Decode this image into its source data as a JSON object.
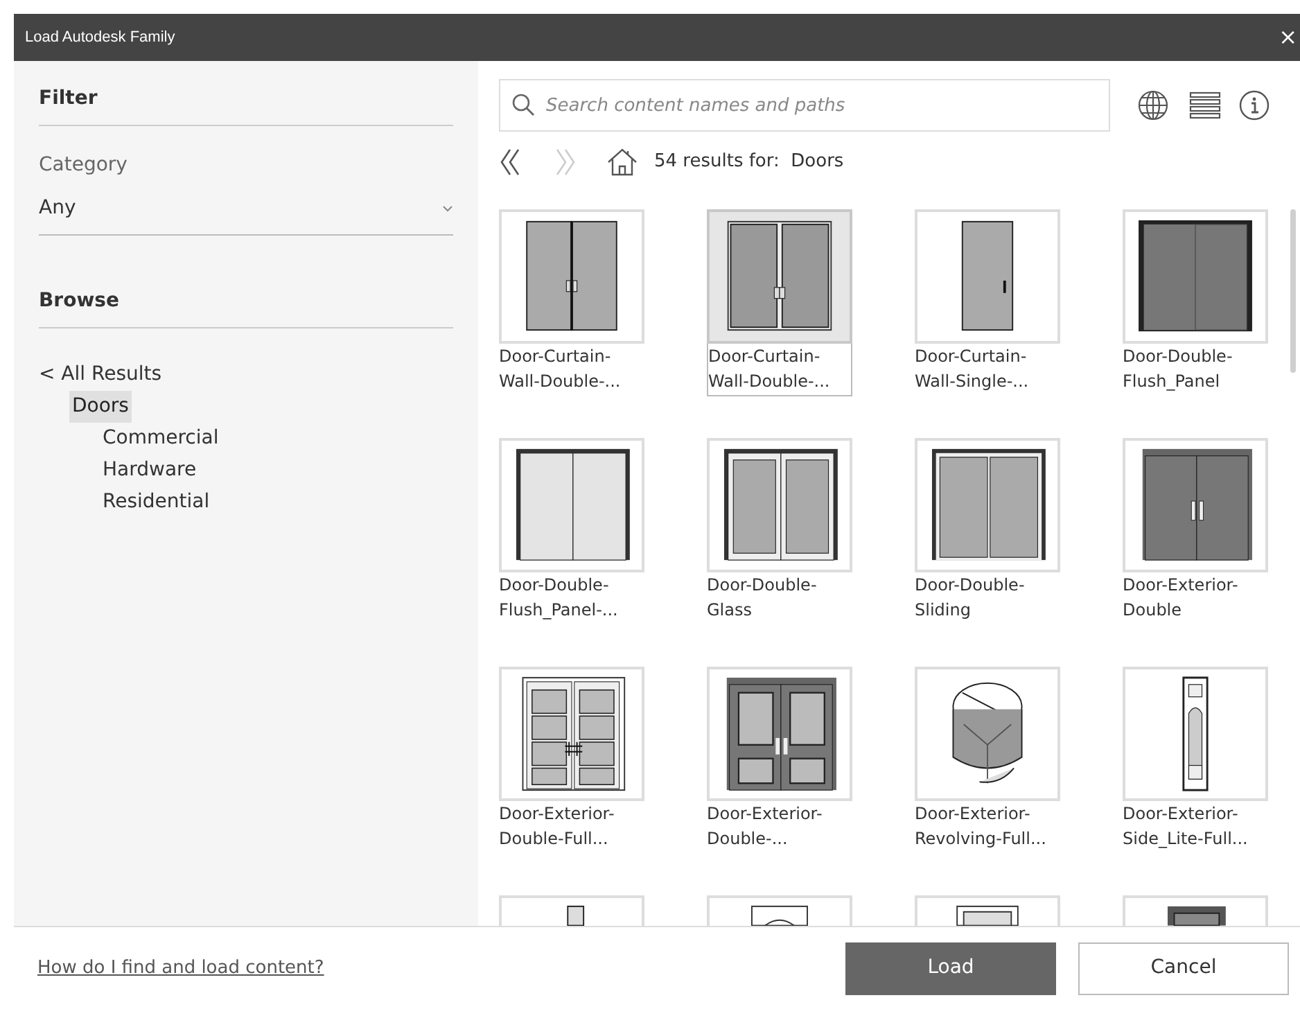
{
  "window": {
    "title": "Load Autodesk Family",
    "close": "×"
  },
  "filter": {
    "heading": "Filter",
    "category_label": "Category",
    "category_value": "Any"
  },
  "browse": {
    "heading": "Browse",
    "back_link": "< All Results",
    "tree": [
      {
        "label": "Doors",
        "selected": true,
        "children": [
          {
            "label": "Commercial",
            "selected": false
          },
          {
            "label": "Hardware",
            "selected": false
          },
          {
            "label": "Residential",
            "selected": false
          }
        ]
      }
    ]
  },
  "search": {
    "placeholder": "Search content names and paths"
  },
  "nav": {
    "back_disabled": false,
    "forward_disabled": true,
    "results": "54 results for:  Doors"
  },
  "items": [
    {
      "label": "Door-Curtain-Wall-Double-...",
      "selected": false
    },
    {
      "label": "Door-Curtain-Wall-Double-...",
      "selected": true
    },
    {
      "label": "Door-Curtain-Wall-Single-...",
      "selected": false
    },
    {
      "label": "Door-Double-Flush_Panel",
      "selected": false
    },
    {
      "label": "Door-Double-Flush_Panel-...",
      "selected": false
    },
    {
      "label": "Door-Double-Glass",
      "selected": false
    },
    {
      "label": "Door-Double-Sliding",
      "selected": false
    },
    {
      "label": "Door-Exterior-Double",
      "selected": false
    },
    {
      "label": "Door-Exterior-Double-Full...",
      "selected": false
    },
    {
      "label": "Door-Exterior-Double-...",
      "selected": false
    },
    {
      "label": "Door-Exterior-Revolving-Full...",
      "selected": false
    },
    {
      "label": "Door-Exterior-Side_Lite-Full...",
      "selected": false
    },
    {
      "selected": false
    },
    {
      "selected": false
    },
    {
      "selected": false
    },
    {
      "selected": false
    }
  ],
  "footer": {
    "help_link": "How do I find and load content?",
    "buttons": [
      {
        "label": "Load",
        "kind": "primary"
      },
      {
        "label": "Cancel",
        "kind": "secondary"
      }
    ]
  }
}
